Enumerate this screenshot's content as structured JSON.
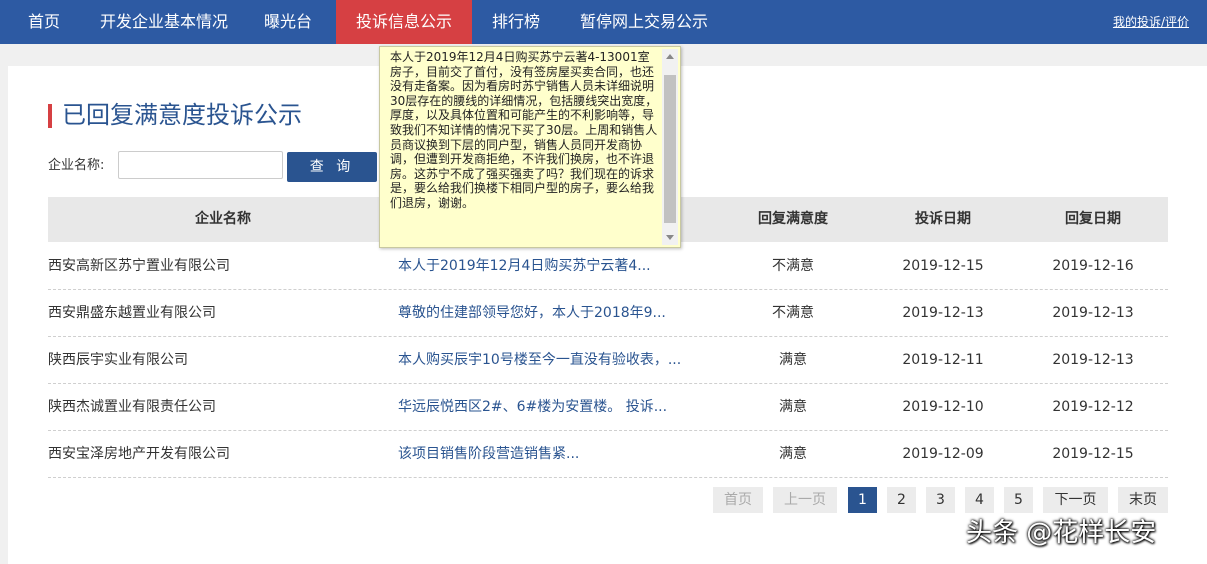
{
  "nav": {
    "items": [
      {
        "label": "首页",
        "active": false
      },
      {
        "label": "开发企业基本情况",
        "active": false
      },
      {
        "label": "曝光台",
        "active": false
      },
      {
        "label": "投诉信息公示",
        "active": true
      },
      {
        "label": "排行榜",
        "active": false
      },
      {
        "label": "暂停网上交易公示",
        "active": false
      }
    ],
    "right_link": "我的投诉/评价",
    "colors": {
      "bar": "#2d5aa3",
      "active": "#d64043"
    }
  },
  "page": {
    "title": "已回复满意度投诉公示"
  },
  "filter": {
    "label": "企业名称:",
    "input_value": "",
    "query_button": "查 询"
  },
  "table": {
    "headers": [
      "企业名称",
      "回复满意度",
      "投诉日期",
      "回复日期"
    ],
    "rows": [
      {
        "company": "西安高新区苏宁置业有限公司",
        "content": "本人于2019年12月4日购买苏宁云著4...",
        "satisfaction": "不满意",
        "complaint_date": "2019-12-15",
        "reply_date": "2019-12-16"
      },
      {
        "company": "西安鼎盛东越置业有限公司",
        "content": "尊敬的住建部领导您好，本人于2018年9...",
        "satisfaction": "不满意",
        "complaint_date": "2019-12-13",
        "reply_date": "2019-12-13"
      },
      {
        "company": "陕西辰宇实业有限公司",
        "content": "本人购买辰宇10号楼至今一直没有验收表，...",
        "satisfaction": "满意",
        "complaint_date": "2019-12-11",
        "reply_date": "2019-12-13"
      },
      {
        "company": "陕西杰诚置业有限责任公司",
        "content": "华远辰悦西区2#、6#楼为安置楼。 投诉...",
        "satisfaction": "满意",
        "complaint_date": "2019-12-10",
        "reply_date": "2019-12-12"
      },
      {
        "company": "西安宝泽房地产开发有限公司",
        "content": "该项目销售阶段营造销售紧...",
        "satisfaction": "满意",
        "complaint_date": "2019-12-09",
        "reply_date": "2019-12-15"
      }
    ]
  },
  "pagination": {
    "first": "首页",
    "prev": "上一页",
    "pages": [
      "1",
      "2",
      "3",
      "4",
      "5"
    ],
    "current_page": 1,
    "next": "下一页",
    "last": "末页"
  },
  "tooltip": {
    "text": "本人于2019年12月4日购买苏宁云著4-13001室房子，目前交了首付，没有签房屋买卖合同，也还没有走备案。因为看房时苏宁销售人员未详细说明30层存在的腰线的详细情况，包括腰线突出宽度，厚度，以及具体位置和可能产生的不利影响等，导致我们不知详情的情况下买了30层。上周和销售人员商议换到下层的同户型，销售人员同开发商协调，但遭到开发商拒绝，不许我们换房，也不许退房。这苏宁不成了强买强卖了吗？我们现在的诉求是，要么给我们换楼下相同户型的房子，要么给我们退房，谢谢。"
  },
  "watermark": "头条 @花样长安"
}
